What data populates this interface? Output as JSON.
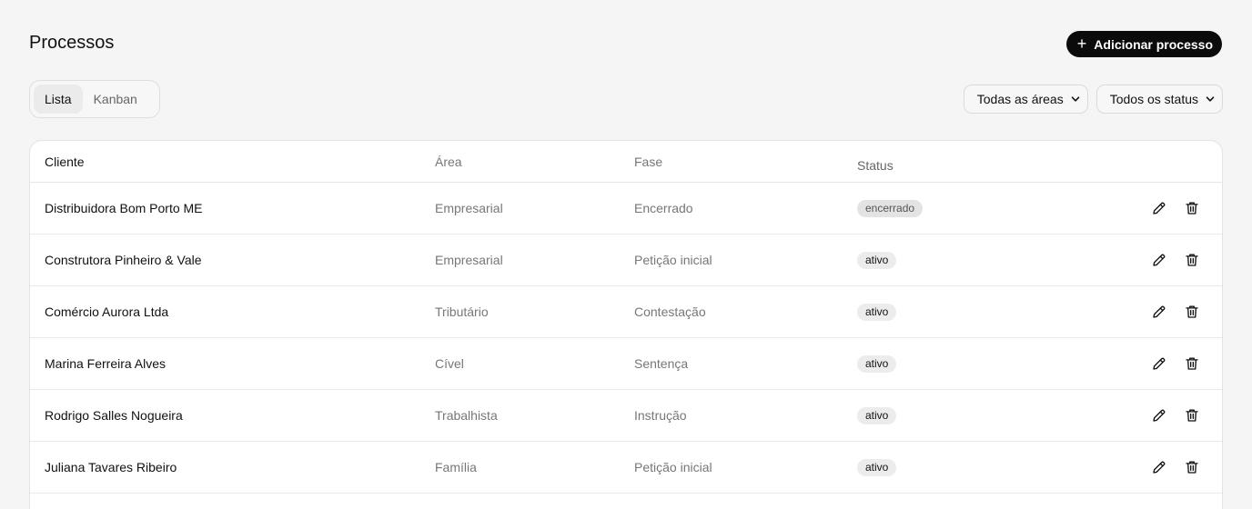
{
  "header": {
    "title": "Processos",
    "add_button_label": "Adicionar processo",
    "add_icon": "+"
  },
  "view_toggle": {
    "tabs": [
      {
        "label": "Lista",
        "active": true
      },
      {
        "label": "Kanban",
        "active": false
      }
    ]
  },
  "filters": {
    "area": {
      "selected": "Todas as áreas"
    },
    "status": {
      "selected": "Todos os status"
    }
  },
  "table": {
    "columns": [
      "Cliente",
      "Área",
      "Fase",
      "Status"
    ],
    "rows": [
      {
        "cliente": "Distribuidora Bom Porto ME",
        "area": "Empresarial",
        "fase": "Encerrado",
        "status": "encerrado"
      },
      {
        "cliente": "Construtora Pinheiro & Vale",
        "area": "Empresarial",
        "fase": "Petição inicial",
        "status": "ativo"
      },
      {
        "cliente": "Comércio Aurora Ltda",
        "area": "Tributário",
        "fase": "Contestação",
        "status": "ativo"
      },
      {
        "cliente": "Marina Ferreira Alves",
        "area": "Cível",
        "fase": "Sentença",
        "status": "ativo"
      },
      {
        "cliente": "Rodrigo Salles Nogueira",
        "area": "Trabalhista",
        "fase": "Instrução",
        "status": "ativo"
      },
      {
        "cliente": "Juliana Tavares Ribeiro",
        "area": "Família",
        "fase": "Petição inicial",
        "status": "ativo"
      }
    ]
  },
  "colors": {
    "primary": "#0b0b0b",
    "background": "#f5f5f5",
    "card": "#ffffff",
    "badge_ativo": "#ececec",
    "badge_encerrado": "#e3e3e3"
  }
}
